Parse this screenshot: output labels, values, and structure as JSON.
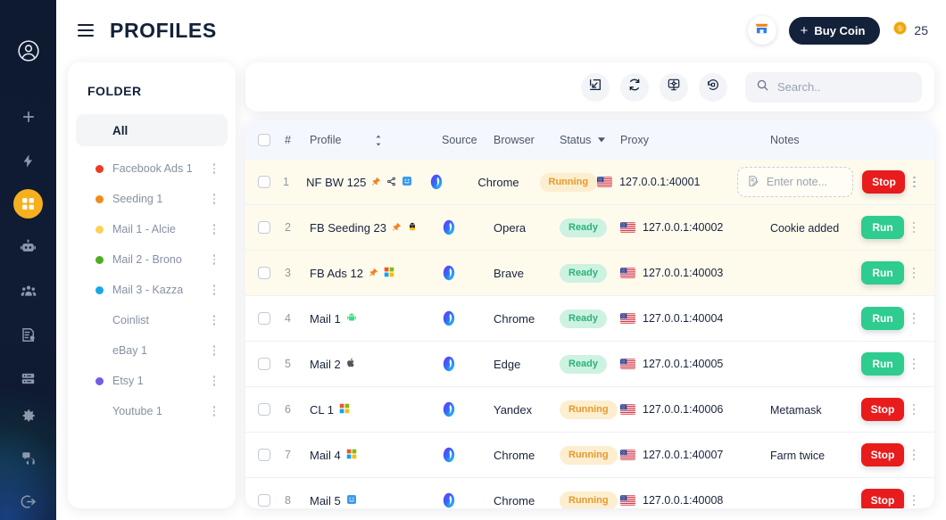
{
  "rail": {
    "items": [
      {
        "name": "account-avatar",
        "icon": "user-circle-icon"
      },
      {
        "name": "add",
        "icon": "plus-icon"
      },
      {
        "name": "automation",
        "icon": "lightning-icon"
      },
      {
        "name": "profiles",
        "icon": "grid-icon",
        "active": true
      },
      {
        "name": "bot",
        "icon": "robot-icon"
      },
      {
        "name": "team",
        "icon": "team-icon"
      },
      {
        "name": "billing",
        "icon": "invoice-icon"
      },
      {
        "name": "servers",
        "icon": "server-icon"
      },
      {
        "name": "settings",
        "icon": "gear-icon"
      },
      {
        "name": "support",
        "icon": "headset-icon"
      },
      {
        "name": "logout",
        "icon": "logout-icon"
      }
    ],
    "active_color": "#f6b01e",
    "background": "#101c34"
  },
  "header": {
    "menu_icon": "hamburger-icon",
    "title": "PROFILES",
    "shop_icon": "store-icon",
    "buy_coin_label": "Buy Coin",
    "buy_coin_plus": "+",
    "coin_icon": "coin-icon",
    "coin_balance": "25",
    "buy_coin_bg": "#13213b"
  },
  "folder": {
    "title": "FOLDER",
    "items": [
      {
        "label": "All",
        "color": null,
        "selected": true
      },
      {
        "label": "Facebook Ads 1",
        "color": "#ec3b22"
      },
      {
        "label": "Seeding 1",
        "color": "#f08c1a"
      },
      {
        "label": "Mail 1 - Alcie",
        "color": "#fad257"
      },
      {
        "label": "Mail 2 - Brono",
        "color": "#4fae1f"
      },
      {
        "label": "Mail 3 - Kazza",
        "color": "#16a9e8"
      },
      {
        "label": "Coinlist",
        "color": null
      },
      {
        "label": "eBay 1",
        "color": null
      },
      {
        "label": "Etsy 1",
        "color": "#6f5de8"
      },
      {
        "label": "Youtube 1",
        "color": null
      }
    ]
  },
  "toolbar": {
    "buttons": [
      {
        "name": "import-button",
        "icon": "import-arrow-icon"
      },
      {
        "name": "sync-button",
        "icon": "refresh-icon"
      },
      {
        "name": "screen-settings-button",
        "icon": "monitor-settings-icon"
      },
      {
        "name": "history-button",
        "icon": "history-restore-icon"
      }
    ],
    "search": {
      "icon": "search-icon",
      "placeholder": "Search..",
      "value": ""
    }
  },
  "table": {
    "columns": {
      "select": "",
      "num": "#",
      "profile": "Profile",
      "profile_sort_icon": "sort-updown-icon",
      "source": "Source",
      "browser": "Browser",
      "status": "Status",
      "status_caret": "caret-down-icon",
      "proxy": "Proxy",
      "notes": "Notes"
    },
    "note_placeholder": "Enter note...",
    "note_icon": "note-edit-icon",
    "rows": [
      {
        "num": "1",
        "profile": "NF BW 125",
        "tags": [
          "pin-icon",
          "share-icon",
          "macos-face-icon"
        ],
        "source_icon": "app-source-icon",
        "browser": "Chrome",
        "status": "Running",
        "proxy": "127.0.0.1:40001",
        "proxy_flag": "us-flag-icon",
        "note": "",
        "note_is_input": true,
        "action": "Stop",
        "action_kind": "stop",
        "highlight": true
      },
      {
        "num": "2",
        "profile": "FB Seeding 23",
        "tags": [
          "pin-icon",
          "linux-penguin-icon"
        ],
        "source_icon": "app-source-icon",
        "browser": "Opera",
        "status": "Ready",
        "proxy": "127.0.0.1:40002",
        "proxy_flag": "us-flag-icon",
        "note": "Cookie added",
        "note_is_input": false,
        "action": "Run",
        "action_kind": "run",
        "highlight": true
      },
      {
        "num": "3",
        "profile": "FB Ads 12",
        "tags": [
          "pin-icon",
          "windows-icon"
        ],
        "source_icon": "app-source-icon",
        "browser": "Brave",
        "status": "Ready",
        "proxy": "127.0.0.1:40003",
        "proxy_flag": "us-flag-icon",
        "note": "",
        "note_is_input": false,
        "action": "Run",
        "action_kind": "run",
        "highlight": true
      },
      {
        "num": "4",
        "profile": "Mail 1",
        "tags": [
          "android-icon"
        ],
        "source_icon": "app-source-icon",
        "browser": "Chrome",
        "status": "Ready",
        "proxy": "127.0.0.1:40004",
        "proxy_flag": "us-flag-icon",
        "note": "",
        "note_is_input": false,
        "action": "Run",
        "action_kind": "run",
        "highlight": false
      },
      {
        "num": "5",
        "profile": "Mail 2",
        "tags": [
          "apple-icon"
        ],
        "source_icon": "app-source-icon",
        "browser": "Edge",
        "status": "Ready",
        "proxy": "127.0.0.1:40005",
        "proxy_flag": "us-flag-icon",
        "note": "",
        "note_is_input": false,
        "action": "Run",
        "action_kind": "run",
        "highlight": false
      },
      {
        "num": "6",
        "profile": "CL 1",
        "tags": [
          "windows-icon"
        ],
        "source_icon": "app-source-icon",
        "browser": "Yandex",
        "status": "Running",
        "proxy": "127.0.0.1:40006",
        "proxy_flag": "us-flag-icon",
        "note": "Metamask",
        "note_is_input": false,
        "action": "Stop",
        "action_kind": "stop",
        "highlight": false
      },
      {
        "num": "7",
        "profile": "Mail 4",
        "tags": [
          "windows-icon"
        ],
        "source_icon": "app-source-icon",
        "browser": "Chrome",
        "status": "Running",
        "proxy": "127.0.0.1:40007",
        "proxy_flag": "us-flag-icon",
        "note": "Farm twice",
        "note_is_input": false,
        "action": "Stop",
        "action_kind": "stop",
        "highlight": false
      },
      {
        "num": "8",
        "profile": "Mail 5",
        "tags": [
          "macos-face-icon"
        ],
        "source_icon": "app-source-icon",
        "browser": "Chrome",
        "status": "Running",
        "proxy": "127.0.0.1:40008",
        "proxy_flag": "us-flag-icon",
        "note": "",
        "note_is_input": false,
        "action": "Stop",
        "action_kind": "stop",
        "highlight": false
      }
    ]
  },
  "colors": {
    "status_running_bg": "#fceecf",
    "status_running_fg": "#e59a2e",
    "status_ready_bg": "#cdf2e1",
    "status_ready_fg": "#2bb27a",
    "stop_bg": "#e81c1c",
    "run_bg": "#2ecc8f",
    "row_highlight": "#fefbed",
    "thead_bg": "#f4f7fd"
  }
}
